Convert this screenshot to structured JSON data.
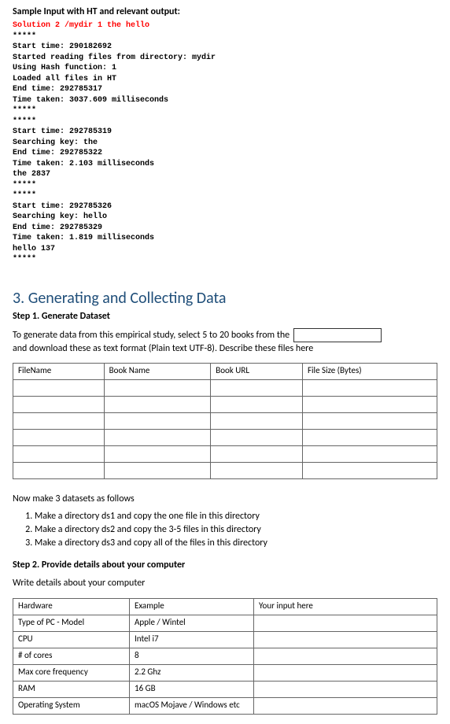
{
  "topLabel": "Sample Input with HT and relevant output:",
  "code": {
    "redLine": "Solution 2 /mydir 1 the hello",
    "block": "*****\nStart time: 290182692\nStarted reading files from directory: mydir\nUsing Hash function: 1\nLoaded all files in HT\nEnd time: 292785317\nTime taken: 3037.609 milliseconds\n*****\n*****\nStart time: 292785319\nSearching key: the\nEnd time: 292785322\nTime taken: 2.103 milliseconds\nthe 2837\n*****\n*****\nStart time: 292785326\nSearching key: hello\nEnd time: 292785329\nTime taken: 1.819 milliseconds\nhello 137\n*****"
  },
  "heading": "3. Generating and Collecting Data",
  "step1": {
    "label": "Step 1. Generate Dataset",
    "textA": "To generate data from this empirical study, select 5 to 20 books from the",
    "textB": "and download these as text format (Plain text UTF-8). Describe these files here"
  },
  "filesTable": {
    "headers": [
      "FileName",
      "Book Name",
      "Book URL",
      "File Size (Bytes)"
    ]
  },
  "datasetsIntro": "Now make 3 datasets as follows",
  "datasetsList": [
    "Make a directory ds1 and copy the one file in this directory",
    "Make a directory ds2 and copy the 3-5 files in this directory",
    "Make a directory ds3 and copy all of the files in this directory"
  ],
  "step2": {
    "label": "Step 2. Provide details about your computer",
    "intro": "Write details about your computer"
  },
  "hwTable": {
    "headers": [
      "Hardware",
      "Example",
      "Your input here"
    ],
    "rows": [
      [
        "Type of PC - Model",
        "Apple / Wintel",
        ""
      ],
      [
        "CPU",
        "Intel i7",
        ""
      ],
      [
        "# of cores",
        "8",
        ""
      ],
      [
        "Max core frequency",
        "2.2 Ghz",
        ""
      ],
      [
        "RAM",
        "16 GB",
        ""
      ],
      [
        "Operating System",
        "macOS Mojave / Windows etc",
        ""
      ]
    ]
  }
}
